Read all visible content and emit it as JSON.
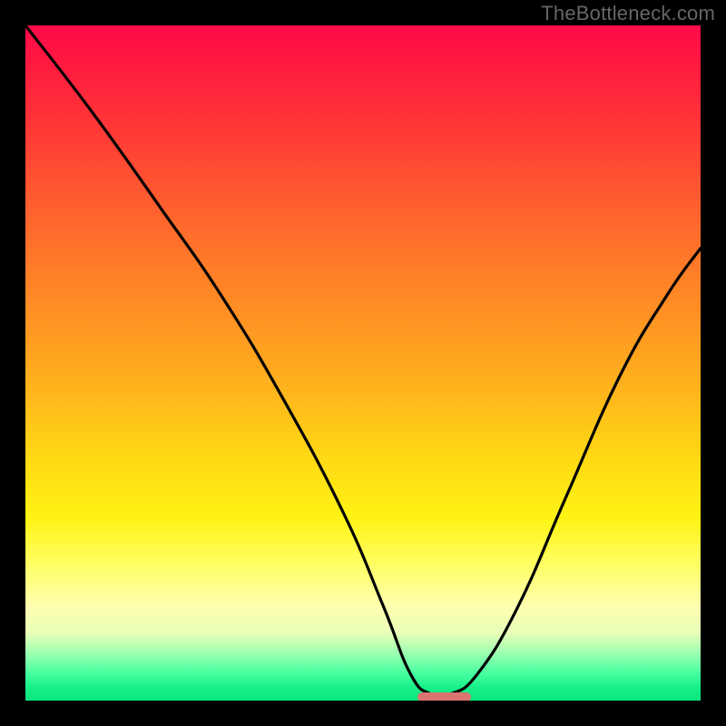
{
  "attribution": "TheBottleneck.com",
  "colors": {
    "frame_bg": "#000000",
    "curve_stroke": "#000000",
    "marker_fill": "#d9746e"
  },
  "chart_data": {
    "type": "line",
    "title": "",
    "xlabel": "",
    "ylabel": "",
    "xlim": [
      0,
      100
    ],
    "ylim": [
      0,
      100
    ],
    "grid": false,
    "legend": false,
    "series": [
      {
        "name": "bottleneck-curve",
        "x": [
          0,
          10,
          20,
          29,
          38,
          47,
          53,
          57,
          60,
          63,
          67,
          73,
          80,
          88,
          95,
          100
        ],
        "values": [
          100,
          87,
          73,
          60,
          45,
          28,
          14,
          4,
          1,
          1,
          4,
          14,
          30,
          48,
          60,
          67
        ]
      }
    ],
    "marker": {
      "name": "optimal-range",
      "x_start": 58,
      "x_end": 66,
      "y": 0.6
    },
    "gradient_stops": [
      {
        "pos": 0,
        "color": "#ff0a4a"
      },
      {
        "pos": 16,
        "color": "#ff3a36"
      },
      {
        "pos": 42,
        "color": "#ff8e24"
      },
      {
        "pos": 64,
        "color": "#ffd914"
      },
      {
        "pos": 86,
        "color": "#ffffb0"
      },
      {
        "pos": 96,
        "color": "#46ffa0"
      },
      {
        "pos": 100,
        "color": "#0ae67e"
      }
    ]
  }
}
